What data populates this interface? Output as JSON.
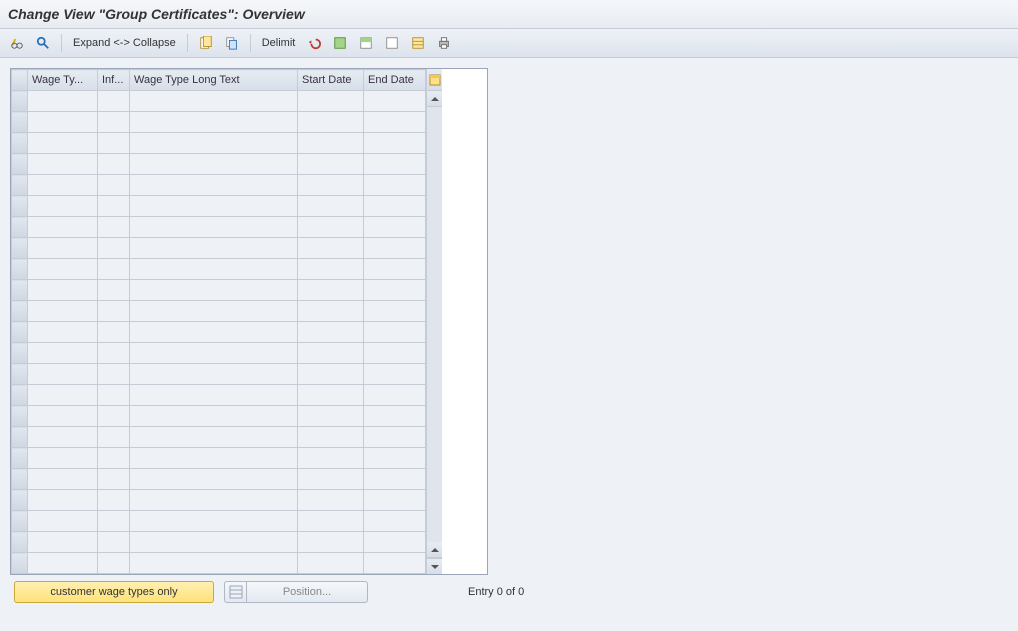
{
  "title": "Change View \"Group Certificates\": Overview",
  "toolbar": {
    "expand_collapse_label": "Expand <-> Collapse",
    "delimit_label": "Delimit"
  },
  "table": {
    "columns": [
      "Wage Ty...",
      "Inf...",
      "Wage Type Long Text",
      "Start Date",
      "End Date"
    ],
    "row_count": 23
  },
  "footer": {
    "customer_button": "customer wage types only",
    "position_button": "Position...",
    "entry_text": "Entry 0 of 0"
  }
}
